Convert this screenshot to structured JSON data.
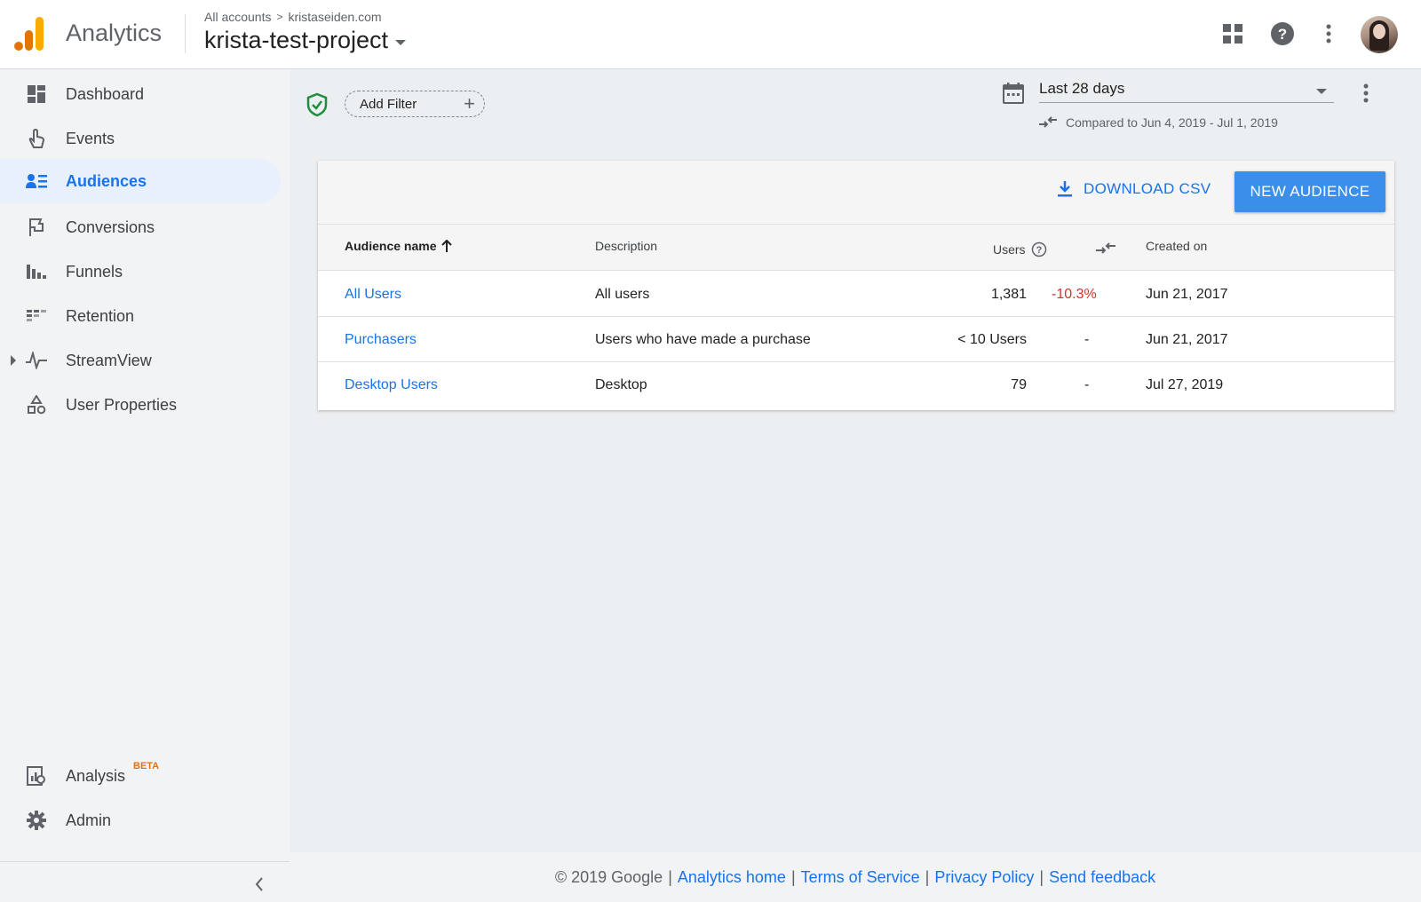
{
  "header": {
    "app_title": "Analytics",
    "breadcrumb": {
      "root": "All accounts",
      "separator": ">",
      "account": "kristaseiden.com"
    },
    "project_name": "krista-test-project",
    "icons": [
      "apps-grid-icon",
      "help-icon",
      "more-vert-icon",
      "avatar"
    ]
  },
  "sidebar": {
    "items": [
      {
        "label": "Dashboard",
        "icon": "dashboard-icon",
        "active": false
      },
      {
        "label": "Events",
        "icon": "touch-icon",
        "active": false
      },
      {
        "label": "Audiences",
        "icon": "audience-icon",
        "active": true
      },
      {
        "label": "Conversions",
        "icon": "flag-icon",
        "active": false
      },
      {
        "label": "Funnels",
        "icon": "funnel-bars-icon",
        "active": false
      },
      {
        "label": "Retention",
        "icon": "retention-icon",
        "active": false
      },
      {
        "label": "StreamView",
        "icon": "pulse-icon",
        "active": false
      },
      {
        "label": "User Properties",
        "icon": "shapes-icon",
        "active": false
      }
    ],
    "bottom_items": [
      {
        "label": "Analysis",
        "badge": "BETA",
        "icon": "analysis-icon"
      },
      {
        "label": "Admin",
        "icon": "gear-icon"
      }
    ]
  },
  "filter_bar": {
    "add_filter_label": "Add Filter",
    "date_range": "Last 28 days",
    "comparison": "Compared to Jun 4, 2019 - Jul 1, 2019"
  },
  "table": {
    "download_label": "DOWNLOAD CSV",
    "new_audience_label": "NEW AUDIENCE",
    "columns": {
      "name": "Audience name",
      "description": "Description",
      "users": "Users",
      "created": "Created on"
    },
    "rows": [
      {
        "name": "All Users",
        "description": "All users",
        "users": "1,381",
        "change": "-10.3%",
        "created": "Jun 21, 2017"
      },
      {
        "name": "Purchasers",
        "description": "Users who have made a purchase",
        "users": "< 10 Users",
        "change": "-",
        "created": "Jun 21, 2017"
      },
      {
        "name": "Desktop Users",
        "description": "Desktop",
        "users": "79",
        "change": "-",
        "created": "Jul 27, 2019"
      }
    ]
  },
  "footer": {
    "copyright": "© 2019 Google",
    "separator": "|",
    "links": [
      "Analytics home",
      "Terms of Service",
      "Privacy Policy",
      "Send feedback"
    ]
  },
  "colors": {
    "accent": "#1a73e8",
    "button_blue": "#3b8eea",
    "negative": "#d93025",
    "logo_orange": "#f9ab00",
    "logo_dark_orange": "#e37400"
  }
}
